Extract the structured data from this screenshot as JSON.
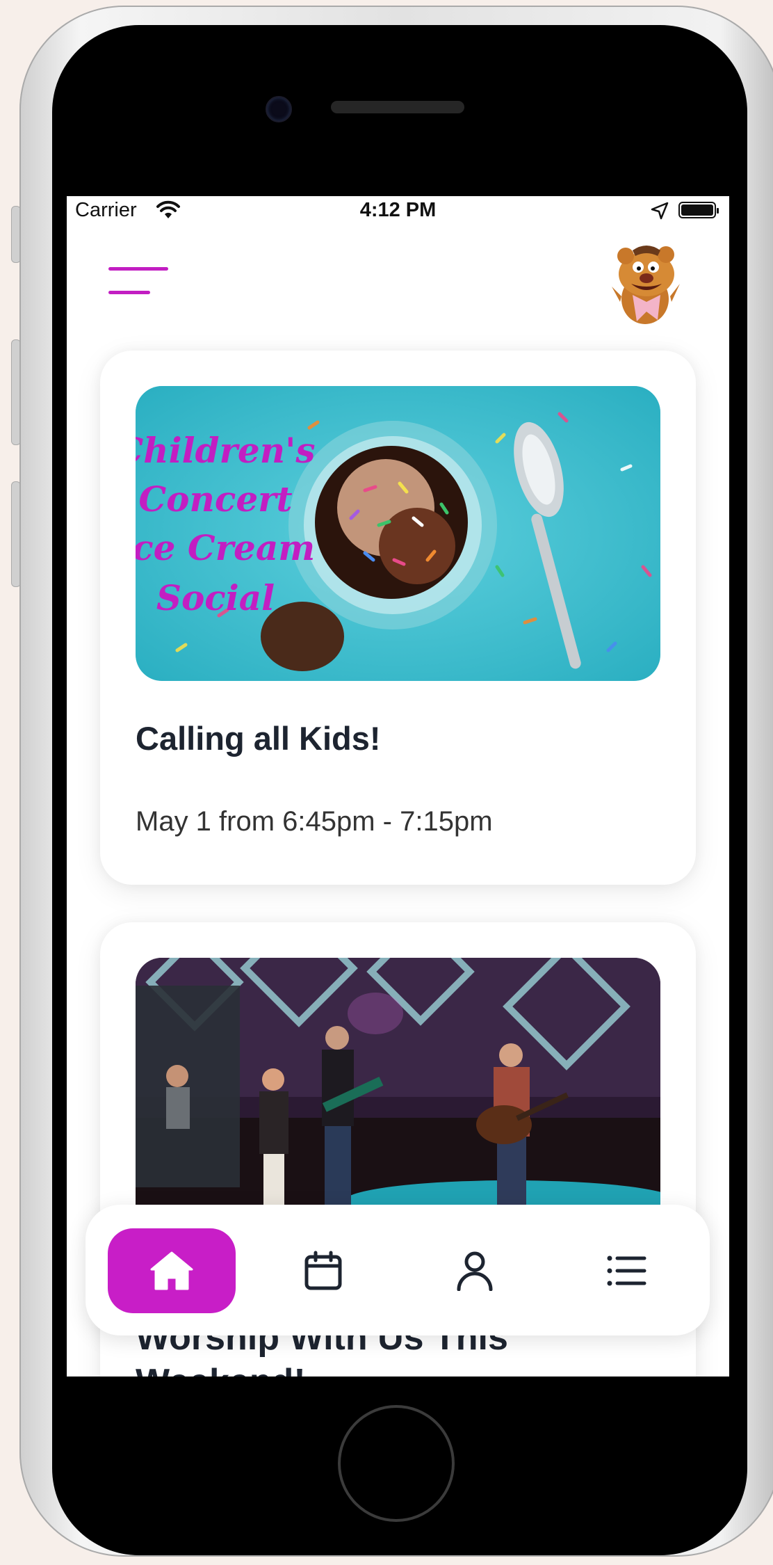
{
  "status_bar": {
    "carrier": "Carrier",
    "time": "4:12 PM"
  },
  "header": {
    "menu_icon": "hamburger-menu-icon",
    "avatar_icon": "muppet-bear-avatar"
  },
  "cards": [
    {
      "image_text": [
        "Children's",
        "Concert",
        "Ice Cream",
        "Social"
      ],
      "title": "Calling all Kids!",
      "subtitle": "May 1 from 6:45pm - 7:15pm"
    },
    {
      "title": "Worship With Us This Weekend!"
    }
  ],
  "tab_bar": {
    "active_color": "#c81ec7",
    "tabs": [
      {
        "icon": "home-icon",
        "active": true
      },
      {
        "icon": "calendar-icon",
        "active": false
      },
      {
        "icon": "profile-icon",
        "active": false
      },
      {
        "icon": "list-icon",
        "active": false
      }
    ]
  },
  "colors": {
    "accent": "#c21ec2",
    "title_text": "#1d2430"
  }
}
